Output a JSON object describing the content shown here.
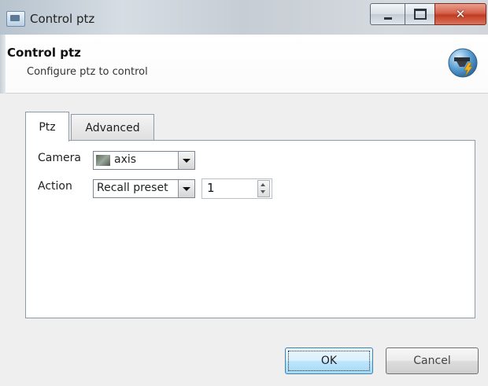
{
  "window": {
    "title": "Control ptz"
  },
  "header": {
    "title": "Control ptz",
    "subtitle": "Configure ptz to control",
    "icon": "ptz-camera-icon"
  },
  "tabs": [
    {
      "label": "Ptz",
      "active": true
    },
    {
      "label": "Advanced",
      "active": false
    }
  ],
  "form": {
    "camera_label": "Camera",
    "camera_value": "axis",
    "action_label": "Action",
    "action_value": "Recall preset",
    "preset_number": "1"
  },
  "buttons": {
    "ok": "OK",
    "cancel": "Cancel"
  },
  "colors": {
    "close_button": "#c13b22",
    "ok_button_border": "#3c7fb1"
  }
}
